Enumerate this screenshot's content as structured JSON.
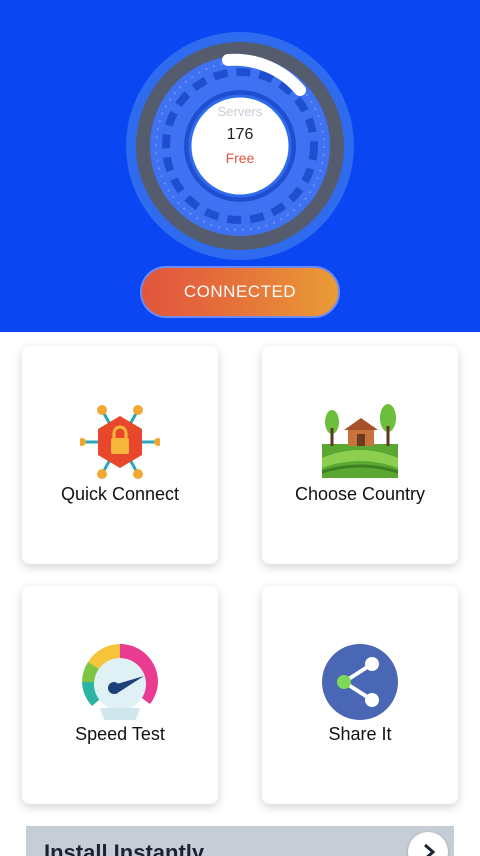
{
  "dial": {
    "servers_label": "Servers",
    "servers_count": "176",
    "tier": "Free"
  },
  "connect_button": {
    "label": "CONNECTED"
  },
  "tiles": [
    {
      "label": "Quick Connect",
      "icon": "shield-lock-network-icon"
    },
    {
      "label": "Choose Country",
      "icon": "farm-landscape-icon"
    },
    {
      "label": "Speed Test",
      "icon": "speedometer-icon"
    },
    {
      "label": "Share It",
      "icon": "share-icon"
    }
  ],
  "ad_banner": {
    "text": "Install Instantly"
  },
  "colors": {
    "header_blue": "#0a47f2",
    "connected_orange": "#e6773a",
    "free_red": "#e0553b",
    "share_blue": "#4a67b5"
  }
}
